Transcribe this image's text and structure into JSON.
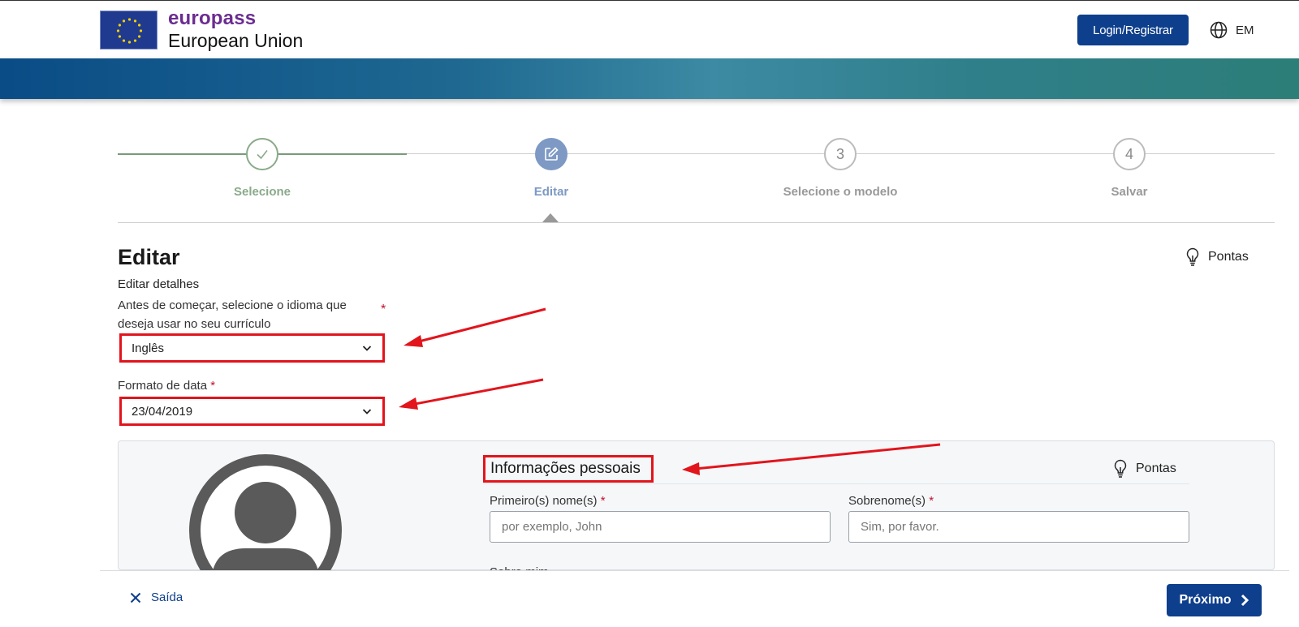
{
  "header": {
    "brand": "europass",
    "org": "European Union",
    "login_label": "Login/Registrar",
    "language_code": "EM",
    "icons": {
      "logo": "eu-flag-icon",
      "language": "globe-icon"
    },
    "colors": {
      "brand": "#6b2c91",
      "primary": "#0e3f8c"
    }
  },
  "stepper": {
    "steps": [
      {
        "label": "Selecione",
        "state": "done",
        "icon": "check-icon"
      },
      {
        "label": "Editar",
        "state": "active",
        "icon": "edit-icon"
      },
      {
        "label": "Selecione o modelo",
        "number": "3",
        "state": "todo"
      },
      {
        "label": "Salvar",
        "number": "4",
        "state": "todo"
      }
    ]
  },
  "edit": {
    "title": "Editar",
    "tips_label": "Pontas",
    "subtitle": "Editar detalhes",
    "language_question": "Antes de começar, selecione o idioma que deseja usar no seu currículo",
    "required_mark": "*",
    "language_value": "Inglês",
    "date_format_label": "Formato de data",
    "date_format_value": "23/04/2019"
  },
  "personal": {
    "title": "Informações pessoais",
    "tips_label": "Pontas",
    "first_name_label": "Primeiro(s) nome(s)",
    "first_name_placeholder": "por exemplo, John",
    "last_name_label": "Sobrenome(s)",
    "last_name_placeholder": "Sim, por favor.",
    "about_label": "Sobre mim"
  },
  "footer": {
    "exit_label": "Saída",
    "next_label": "Próximo"
  },
  "annotations": {
    "arrow_color": "#e2141c"
  }
}
